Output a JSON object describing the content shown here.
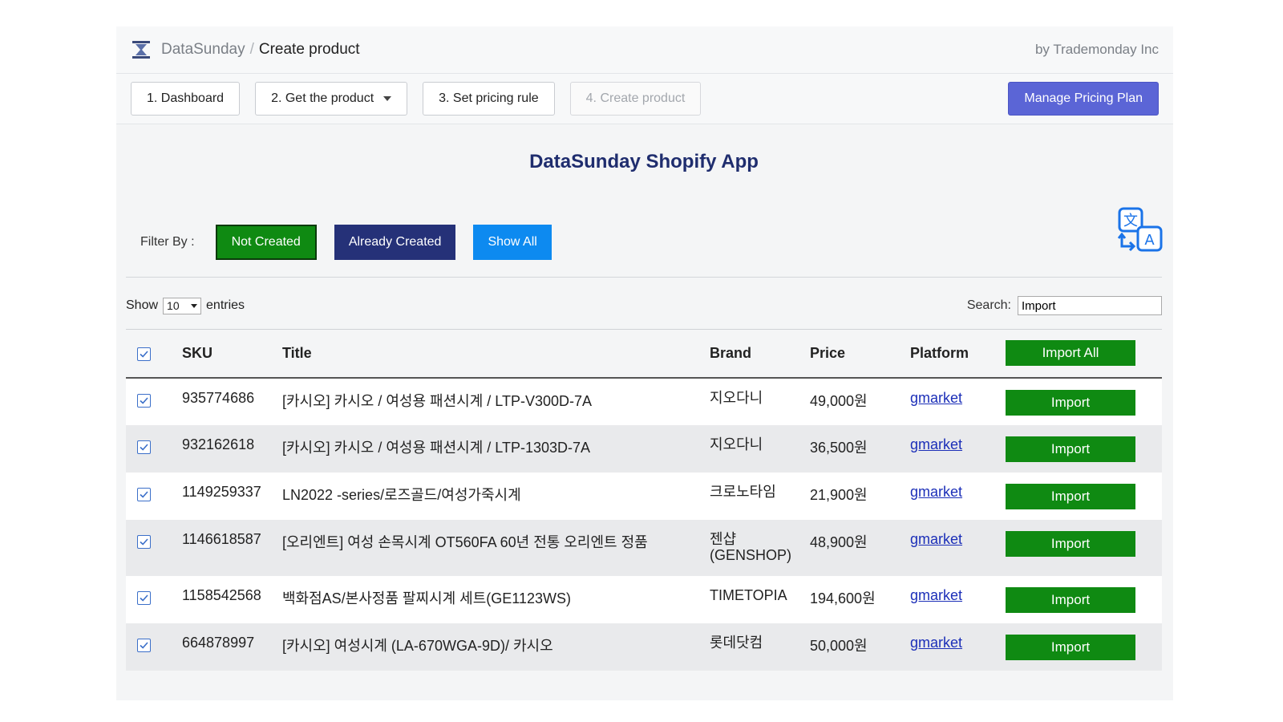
{
  "header": {
    "app_name": "DataSunday",
    "separator": "/",
    "current_page": "Create product",
    "byline": "by Trademonday Inc"
  },
  "nav": {
    "steps": [
      {
        "label": "1. Dashboard"
      },
      {
        "label": "2. Get the product"
      },
      {
        "label": "3. Set pricing rule"
      },
      {
        "label": "4. Create product"
      }
    ],
    "plan_button": "Manage Pricing Plan"
  },
  "main": {
    "title": "DataSunday Shopify App",
    "filter": {
      "label": "Filter By :",
      "not_created": "Not Created",
      "already_created": "Already Created",
      "show_all": "Show All"
    },
    "controls": {
      "show_label": "Show",
      "entries_value": "10",
      "entries_label": "entries",
      "search_label": "Search:",
      "search_value": "Import"
    },
    "table": {
      "headers": {
        "sku": "SKU",
        "title": "Title",
        "brand": "Brand",
        "price": "Price",
        "platform": "Platform",
        "import_all": "Import All"
      },
      "import_label": "Import",
      "rows": [
        {
          "sku": "935774686",
          "title": "[카시오] 카시오 / 여성용 패션시계 / LTP-V300D-7A",
          "brand": "지오다니",
          "price": "49,000원",
          "platform": "gmarket"
        },
        {
          "sku": "932162618",
          "title": "[카시오] 카시오 / 여성용 패션시계 / LTP-1303D-7A",
          "brand": "지오다니",
          "price": "36,500원",
          "platform": "gmarket"
        },
        {
          "sku": "1149259337",
          "title": "LN2022 -series/로즈골드/여성가죽시계",
          "brand": "크로노타임",
          "price": "21,900원",
          "platform": "gmarket"
        },
        {
          "sku": "1146618587",
          "title": "[오리엔트] 여성 손목시계 OT560FA 60년 전통 오리엔트 정품",
          "brand": "젠샵\n(GENSHOP)",
          "price": "48,900원",
          "platform": "gmarket"
        },
        {
          "sku": "1158542568",
          "title": "백화점AS/본사정품 팔찌시계 세트(GE1123WS)",
          "brand": "TIMETOPIA",
          "price": "194,600원",
          "platform": "gmarket"
        },
        {
          "sku": "664878997",
          "title": "[카시오] 여성시계 (LA-670WGA-9D)/ 카시오",
          "brand": "롯데닷컴",
          "price": "50,000원",
          "platform": "gmarket"
        }
      ]
    }
  },
  "colors": {
    "not_created": "#0f8a12",
    "already_created": "#253178",
    "show_all": "#0d8af0",
    "plan_button": "#5b65d6",
    "title": "#1f2d6e"
  }
}
